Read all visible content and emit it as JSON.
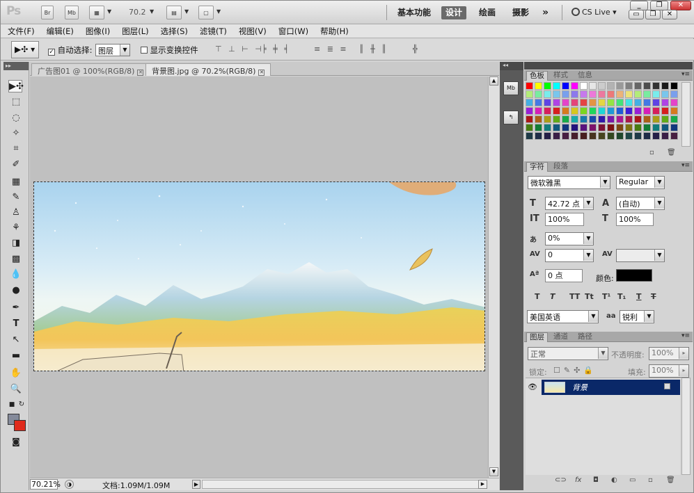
{
  "app": {
    "logo": "Ps",
    "zoom_display": "70.2"
  },
  "workspaces": {
    "basic": "基本功能",
    "design": "设计",
    "paint": "绘画",
    "photo": "摄影",
    "more": "»",
    "cslive": "CS Live"
  },
  "menu": [
    "文件(F)",
    "编辑(E)",
    "图像(I)",
    "图层(L)",
    "选择(S)",
    "滤镜(T)",
    "视图(V)",
    "窗口(W)",
    "帮助(H)"
  ],
  "options": {
    "auto_select": "自动选择:",
    "auto_select_value": "图层",
    "show_transform": "显示变换控件"
  },
  "tabs": [
    {
      "title": "广告图01 @ 100%(RGB/8)"
    },
    {
      "title": "背景图.jpg @ 70.2%(RGB/8)"
    }
  ],
  "status": {
    "zoom": "70.21%",
    "doc_info": "文档:1.09M/1.09M"
  },
  "panels": {
    "swatches": {
      "tabs": [
        "色板",
        "样式",
        "信息"
      ]
    },
    "character": {
      "tabs": [
        "字符",
        "段落"
      ],
      "font": "微软雅黑",
      "style": "Regular",
      "size": "42.72 点",
      "leading": "(自动)",
      "v_scale": "100%",
      "h_scale": "100%",
      "tsume": "0%",
      "kerning": "0",
      "tracking": "",
      "baseline": "0 点",
      "color_label": "颜色:",
      "language": "美国英语",
      "aa_label": "a",
      "aa_value": "锐利"
    },
    "layers": {
      "tabs": [
        "图层",
        "通道",
        "路径"
      ],
      "blend": "正常",
      "opacity_label": "不透明度:",
      "opacity": "100%",
      "lock_label": "锁定:",
      "fill_label": "填充:",
      "fill": "100%",
      "items": [
        {
          "name": "背景"
        }
      ]
    }
  },
  "colors": {
    "foreground": "#848a9a",
    "background": "#e02a1c",
    "text_color": "#000000",
    "layer_selected": "#0a2868"
  }
}
